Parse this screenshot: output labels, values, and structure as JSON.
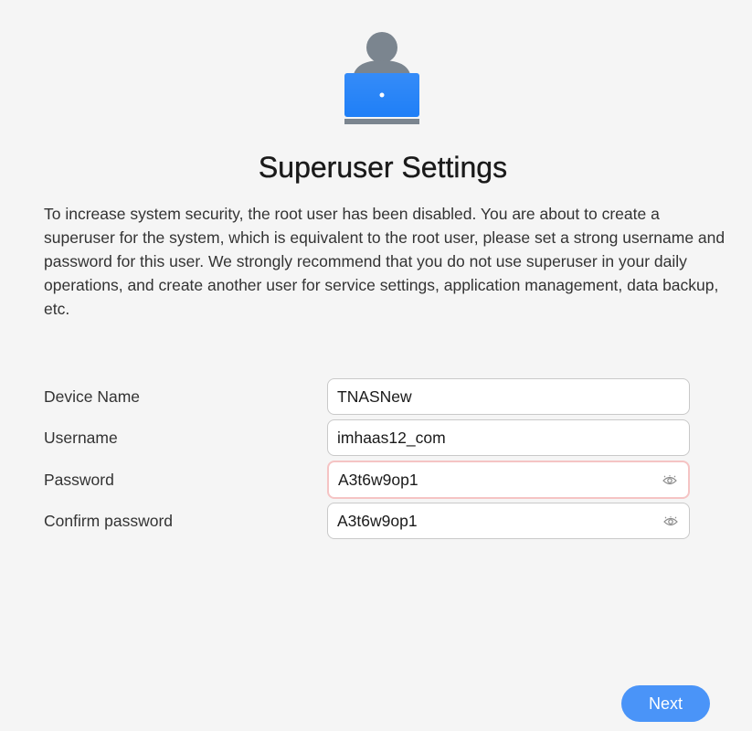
{
  "header": {
    "illustration_icon": "superuser-laptop-icon",
    "title": "Superuser Settings",
    "description": "To increase system security, the root user has been disabled. You are about to create a superuser for the system, which is equivalent to the root user, please set a strong username and password for this user. We strongly recommend that you do not use superuser in your daily operations, and create another user for service settings, application management, data backup, etc."
  },
  "form": {
    "device_name": {
      "label": "Device Name",
      "value": "TNASNew"
    },
    "username": {
      "label": "Username",
      "value": "imhaas12_com"
    },
    "password": {
      "label": "Password",
      "value": "A3t6w9op1",
      "icon": "eye-icon",
      "state": "error"
    },
    "confirm_password": {
      "label": "Confirm password",
      "value": "A3t6w9op1",
      "icon": "eye-icon"
    }
  },
  "actions": {
    "next_label": "Next"
  },
  "colors": {
    "background": "#f5f5f5",
    "accent": "#4a94f8",
    "laptop_blue": "#1f7ff7",
    "avatar_gray": "#7b858f",
    "error_border": "#f5c4c4"
  }
}
